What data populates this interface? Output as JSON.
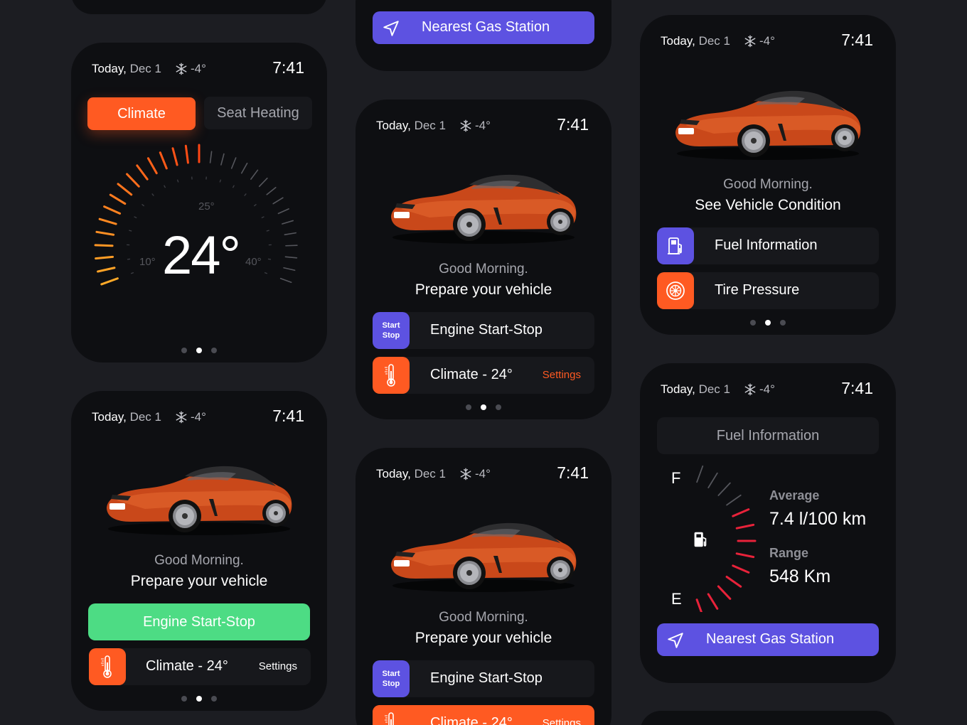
{
  "header": {
    "today": "Today,",
    "month_day": "Dec 1",
    "temperature": "-4°",
    "time": "7:41"
  },
  "greeting": {
    "line1": "Good Morning.",
    "prepare": "Prepare your vehicle",
    "condition": "See Vehicle Condition"
  },
  "nav": {
    "nearest_gas": "Nearest Gas Station"
  },
  "climate_card": {
    "tab_active": "Climate",
    "tab_inactive": "Seat Heating",
    "value": "24°",
    "tick_min": "10°",
    "tick_mid": "25°",
    "tick_max": "40°",
    "accent": "#ff5a22"
  },
  "actions": {
    "engine": "Engine Start-Stop",
    "climate": "Climate - 24°",
    "settings": "Settings",
    "start_icon_line1": "Start",
    "start_icon_line2": "Stop"
  },
  "vehicle": {
    "fuel_info": "Fuel Information",
    "tire_pressure": "Tire Pressure"
  },
  "fuel_card": {
    "title": "Fuel Information",
    "full_label": "F",
    "empty_label": "E",
    "average_label": "Average",
    "average_value": "7.4 l/100 km",
    "range_label": "Range",
    "range_value": "548 Km"
  },
  "colors": {
    "orange": "#ff5a22",
    "purple": "#5d52e1",
    "green": "#4ddc84",
    "red": "#e8223a",
    "bg": "#1c1d22",
    "card": "#0e0f12"
  },
  "pager": {
    "active_index": 1,
    "count": 3
  }
}
